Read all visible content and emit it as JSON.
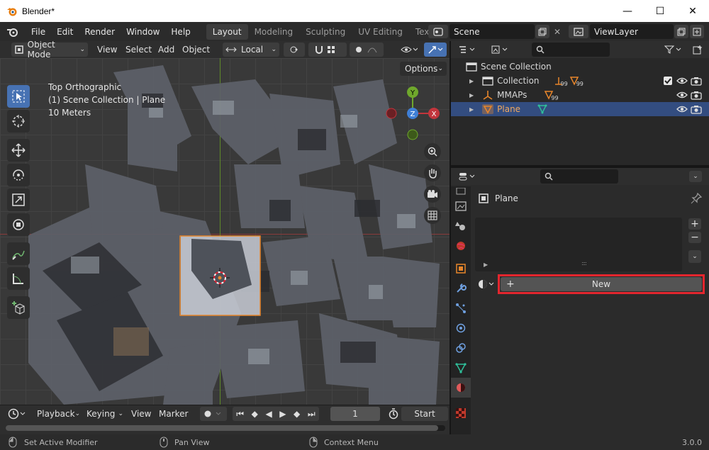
{
  "window": {
    "title": "Blender*",
    "minimize": "—",
    "maximize": "☐",
    "close": "✕"
  },
  "topbar": {
    "menus": [
      "File",
      "Edit",
      "Render",
      "Window",
      "Help"
    ],
    "workspaces": [
      "Layout",
      "Modeling",
      "Sculpting",
      "UV Editing",
      "Texture Paint"
    ],
    "active_workspace": "Layout",
    "scene": "Scene",
    "view_layer": "ViewLayer"
  },
  "viewport": {
    "mode": "Object Mode",
    "menus": [
      "View",
      "Select",
      "Add",
      "Object"
    ],
    "orientation": "Local",
    "options_label": "Options",
    "overlay_lines": [
      "Top Orthographic",
      "(1) Scene Collection | Plane",
      "10 Meters"
    ],
    "gizmo": {
      "y": "Y",
      "z": "Z",
      "x": "X"
    }
  },
  "outliner": {
    "root": "Scene Collection",
    "rows": [
      {
        "label": "Collection",
        "badge1": "99",
        "badge2": "99"
      },
      {
        "label": "MMAPs",
        "badge1": "99"
      },
      {
        "label": "Plane",
        "selected": true
      }
    ]
  },
  "properties": {
    "object_name": "Plane",
    "new_button": "New",
    "list_plus": "+",
    "list_minus": "−",
    "list_handle": "::::"
  },
  "timeline": {
    "menus": [
      "Playback",
      "Keying",
      "View",
      "Marker"
    ],
    "current_frame": "1",
    "start_label": "Start"
  },
  "statusbar": {
    "left": "Set Active Modifier",
    "middle": "Pan View",
    "right": "Context Menu",
    "version": "3.0.0"
  },
  "colors": {
    "accent": "#4772b3",
    "selection": "#334d80",
    "highlight": "#e3262e",
    "orange": "#e8862b"
  }
}
